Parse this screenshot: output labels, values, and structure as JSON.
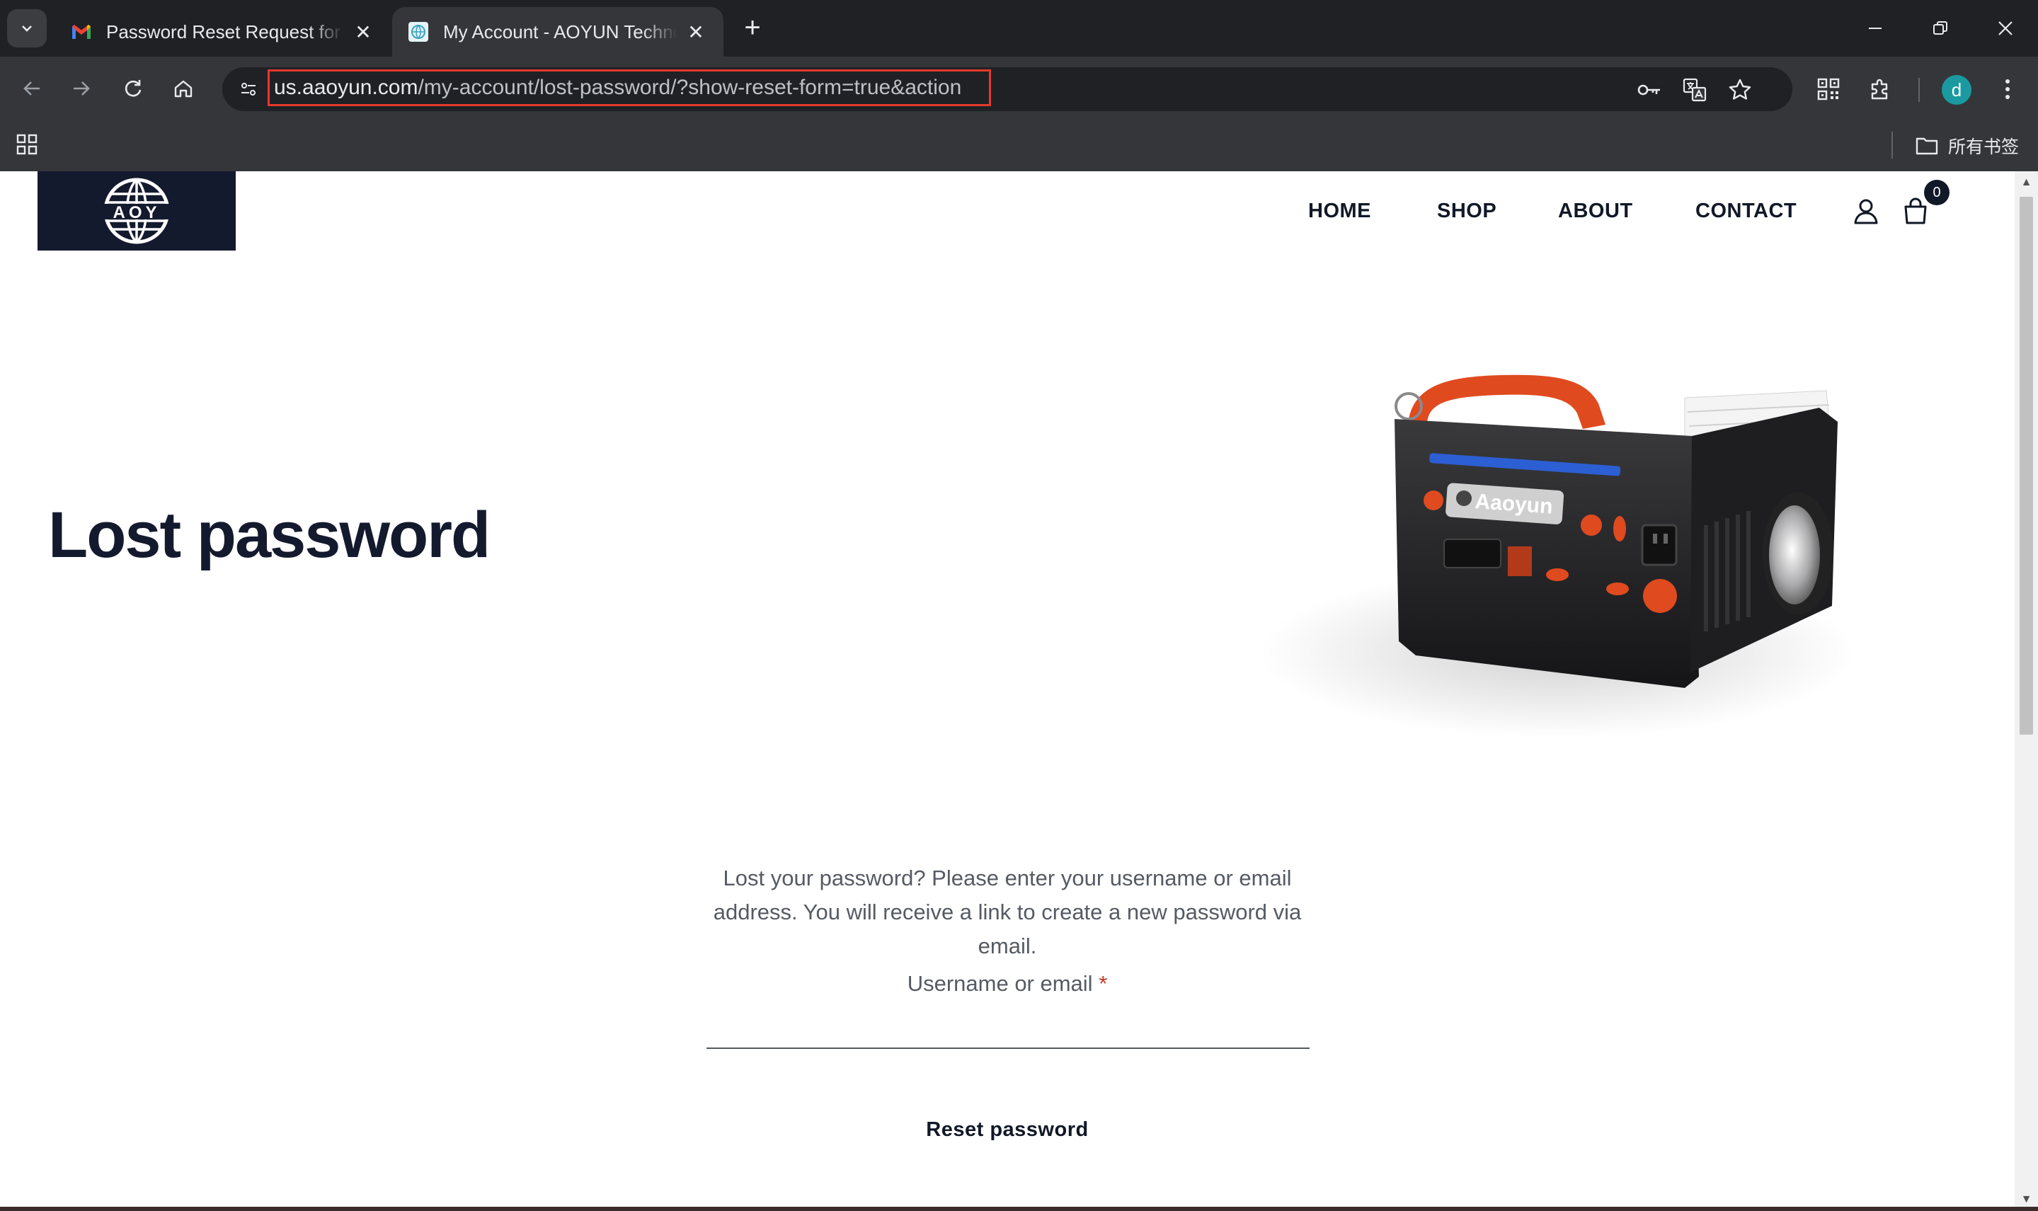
{
  "browser": {
    "tabs": [
      {
        "title": "Password Reset Request for AOYUN",
        "favicon": "gmail-icon",
        "active": false
      },
      {
        "title": "My Account - AOYUN Technology",
        "favicon": "globe-icon",
        "active": true
      }
    ],
    "new_tab_label": "+",
    "url_host": "us.aaoyun.com",
    "url_path": "/my-account/lost-password/?show-reset-form=true&action",
    "profile_initial": "d",
    "bookmarks_all_label": "所有书签",
    "highlight_color": "#e53a2c"
  },
  "site": {
    "logo_text": "AOY",
    "nav": [
      {
        "label": "HOME"
      },
      {
        "label": "SHOP"
      },
      {
        "label": "ABOUT"
      },
      {
        "label": "CONTACT"
      }
    ],
    "cart_count": "0"
  },
  "page": {
    "title": "Lost password",
    "product_brand": "Aaoyun",
    "intro": "Lost your password? Please enter your username or email address. You will receive a link to create a new password via email.",
    "field_label": "Username or email",
    "required_mark": "*",
    "field_value": "",
    "button_label": "Reset password"
  }
}
